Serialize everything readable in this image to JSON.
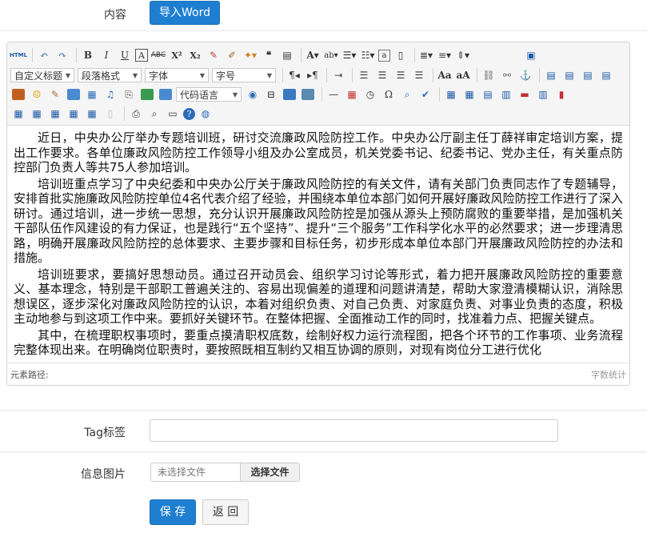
{
  "content_row": {
    "label": "内容",
    "import_button": "导入Word"
  },
  "toolbar": {
    "row1": [
      "HTML",
      "↶",
      "↷",
      "B",
      "I",
      "U",
      "A",
      "ABC",
      "X²",
      "X₂",
      "✎",
      "🖌",
      "✦",
      "❝",
      "📋",
      "A",
      "ab",
      "≡",
      "≡",
      "a",
      "□",
      "≡",
      "≡",
      "≡",
      "▭"
    ],
    "heading_select": "自定义标题",
    "paragraph_select": "段落格式",
    "font_select": "字体",
    "size_select": "字号",
    "code_select": "代码语言"
  },
  "content": {
    "paragraphs": [
      "近日，中央办公厅举办专题培训班，研讨交流廉政风险防控工作。中央办公厅副主任丁薛祥审定培训方案，提出工作要求。各单位廉政风险防控工作领导小组及办公室成员，机关党委书记、纪委书记、党办主任，有关重点防控部门负责人等共75人参加培训。",
      "培训班重点学习了中央纪委和中央办公厅关于廉政风险防控的有关文件，请有关部门负责同志作了专题辅导，安排首批实施廉政风险防控单位4名代表介绍了经验，并围绕本单位本部门如何开展好廉政风险防控工作进行了深入研讨。通过培训，进一步统一思想，充分认识开展廉政风险防控是加强从源头上预防腐败的重要举措，是加强机关干部队伍作风建设的有力保证，也是践行“五个坚持”、提升“三个服务”工作科学化水平的必然要求；进一步理清思路，明确开展廉政风险防控的总体要求、主要步骤和目标任务，初步形成本单位本部门开展廉政风险防控的办法和措施。",
      "培训班要求，要搞好思想动员。通过召开动员会、组织学习讨论等形式，着力把开展廉政风险防控的重要意义、基本理念，特别是干部职工普遍关注的、容易出现偏差的道理和问题讲清楚，帮助大家澄清模糊认识，消除思想误区，逐步深化对廉政风险防控的认识，本着对组织负责、对自己负责、对家庭负责、对事业负责的态度，积极主动地参与到这项工作中来。要抓好关键环节。在整体把握、全面推动工作的同时，找准着力点、把握关键点。",
      "其中，在梳理职权事项时，要重点摸清职权底数，绘制好权力运行流程图，把各个环节的工作事项、业务流程完整体现出来。在明确岗位职责时，要按照既相互制约又相互协调的原则，对现有岗位分工进行优化"
    ]
  },
  "statusbar": {
    "path_label": "元素路径:",
    "word_count": "字数统计"
  },
  "tag_row": {
    "label": "Tag标签",
    "value": ""
  },
  "image_row": {
    "label": "信息图片",
    "no_file": "未选择文件",
    "choose_file": "选择文件"
  },
  "actions": {
    "save": "保 存",
    "back": "返 回"
  },
  "colors": {
    "primary": "#1e7fd1"
  }
}
